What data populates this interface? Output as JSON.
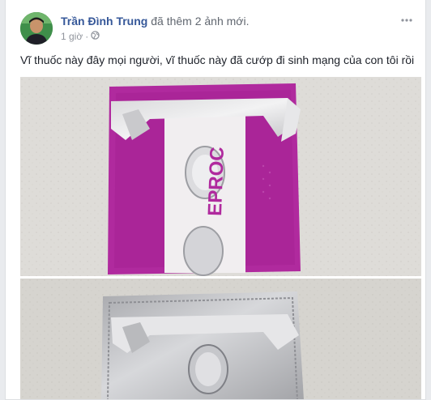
{
  "post": {
    "author": "Trần Đình Trung",
    "action_text": "đã thêm 2 ảnh mới.",
    "time": "1 giờ",
    "separator": "·",
    "privacy_icon": "globe-icon",
    "more_icon": "ellipsis-icon",
    "caption": "Vĩ thuốc này đây mọi người, vĩ thuốc này đã cướp đi sinh mạng của con tôi rồi"
  },
  "photos": {
    "count": 2,
    "pack_print_partial": "EPROC",
    "colors": {
      "pack_purple": "#b02a9e",
      "foil_silver": "#b9babd",
      "counter_gray": "#d8d6d1"
    }
  },
  "theme": {
    "link_color": "#365899",
    "secondary_text": "#90949c",
    "body_text": "#1d2129",
    "page_bg": "#e9ebee"
  }
}
